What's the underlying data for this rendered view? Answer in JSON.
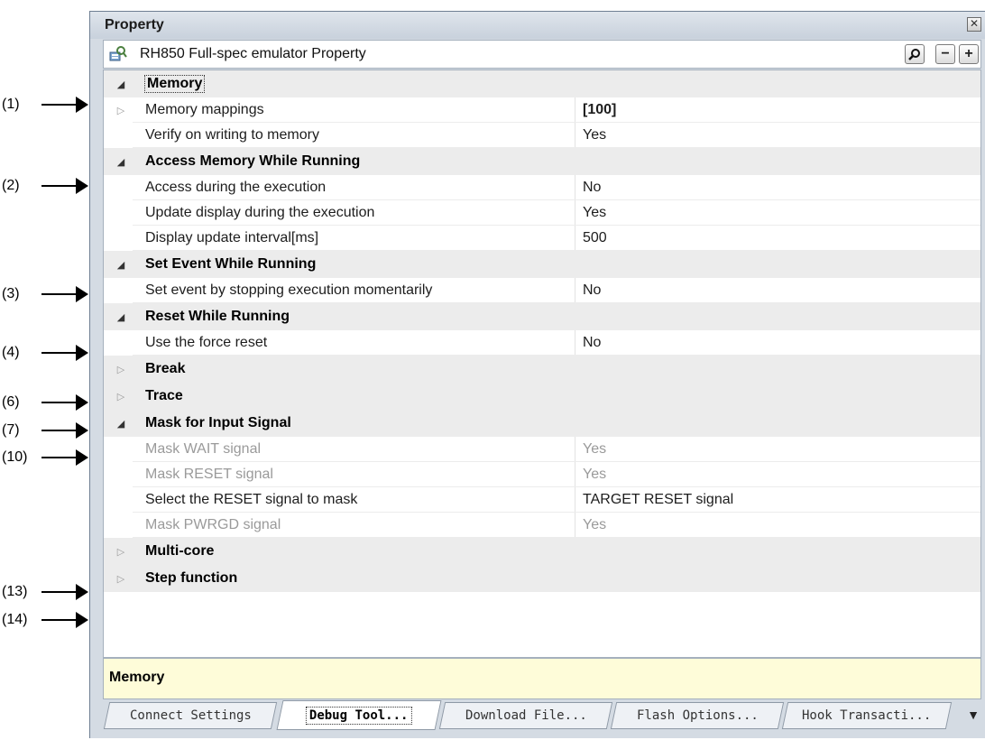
{
  "annotations": [
    "(1)",
    "(2)",
    "(3)",
    "(4)",
    "(6)",
    "(7)",
    "(10)",
    "(13)",
    "(14)"
  ],
  "panel": {
    "title": "Property",
    "close_glyph": "✕",
    "toolbar": {
      "title": "RH850 Full-spec emulator Property",
      "icon": "property-icon",
      "search_icon": "magnifier-icon",
      "collapse_label": "−",
      "expand_label": "+"
    }
  },
  "grid": {
    "rows": [
      {
        "type": "category",
        "expanded": true,
        "name": "Memory",
        "value": ""
      },
      {
        "type": "property",
        "expandable": true,
        "name": "Memory mappings",
        "value": "[100]"
      },
      {
        "type": "property",
        "name": "Verify on writing to memory",
        "value": "Yes"
      },
      {
        "type": "category",
        "expanded": true,
        "name": "Access Memory While Running",
        "value": ""
      },
      {
        "type": "property",
        "name": "Access during the execution",
        "value": "No"
      },
      {
        "type": "property",
        "name": "Update display during the execution",
        "value": "Yes"
      },
      {
        "type": "property",
        "name": "Display update interval[ms]",
        "value": "500"
      },
      {
        "type": "category",
        "expanded": true,
        "name": "Set Event While Running",
        "value": ""
      },
      {
        "type": "property",
        "name": "Set event by stopping execution momentarily",
        "value": "No"
      },
      {
        "type": "category",
        "expanded": true,
        "name": "Reset While Running",
        "value": ""
      },
      {
        "type": "property",
        "name": "Use the force reset",
        "value": "No"
      },
      {
        "type": "category",
        "expanded": false,
        "name": "Break",
        "value": ""
      },
      {
        "type": "category",
        "expanded": false,
        "name": "Trace",
        "value": ""
      },
      {
        "type": "category",
        "expanded": true,
        "name": "Mask for Input Signal",
        "value": ""
      },
      {
        "type": "property",
        "disabled": true,
        "name": "Mask WAIT signal",
        "value": "Yes"
      },
      {
        "type": "property",
        "disabled": true,
        "name": "Mask RESET signal",
        "value": "Yes"
      },
      {
        "type": "property",
        "name": "Select the RESET signal to mask",
        "value": "TARGET RESET signal"
      },
      {
        "type": "property",
        "disabled": true,
        "name": "Mask PWRGD signal",
        "value": "Yes"
      },
      {
        "type": "category",
        "expanded": false,
        "name": "Multi-core",
        "value": ""
      },
      {
        "type": "category",
        "expanded": false,
        "name": "Step function",
        "value": ""
      }
    ]
  },
  "description": "Memory",
  "tabs": [
    {
      "label": "Connect Settings",
      "active": false
    },
    {
      "label": "Debug Tool...",
      "active": true
    },
    {
      "label": "Download File...",
      "active": false
    },
    {
      "label": "Flash Options...",
      "active": false
    },
    {
      "label": "Hook Transacti...",
      "active": false
    }
  ],
  "tab_overflow_glyph": "▼"
}
